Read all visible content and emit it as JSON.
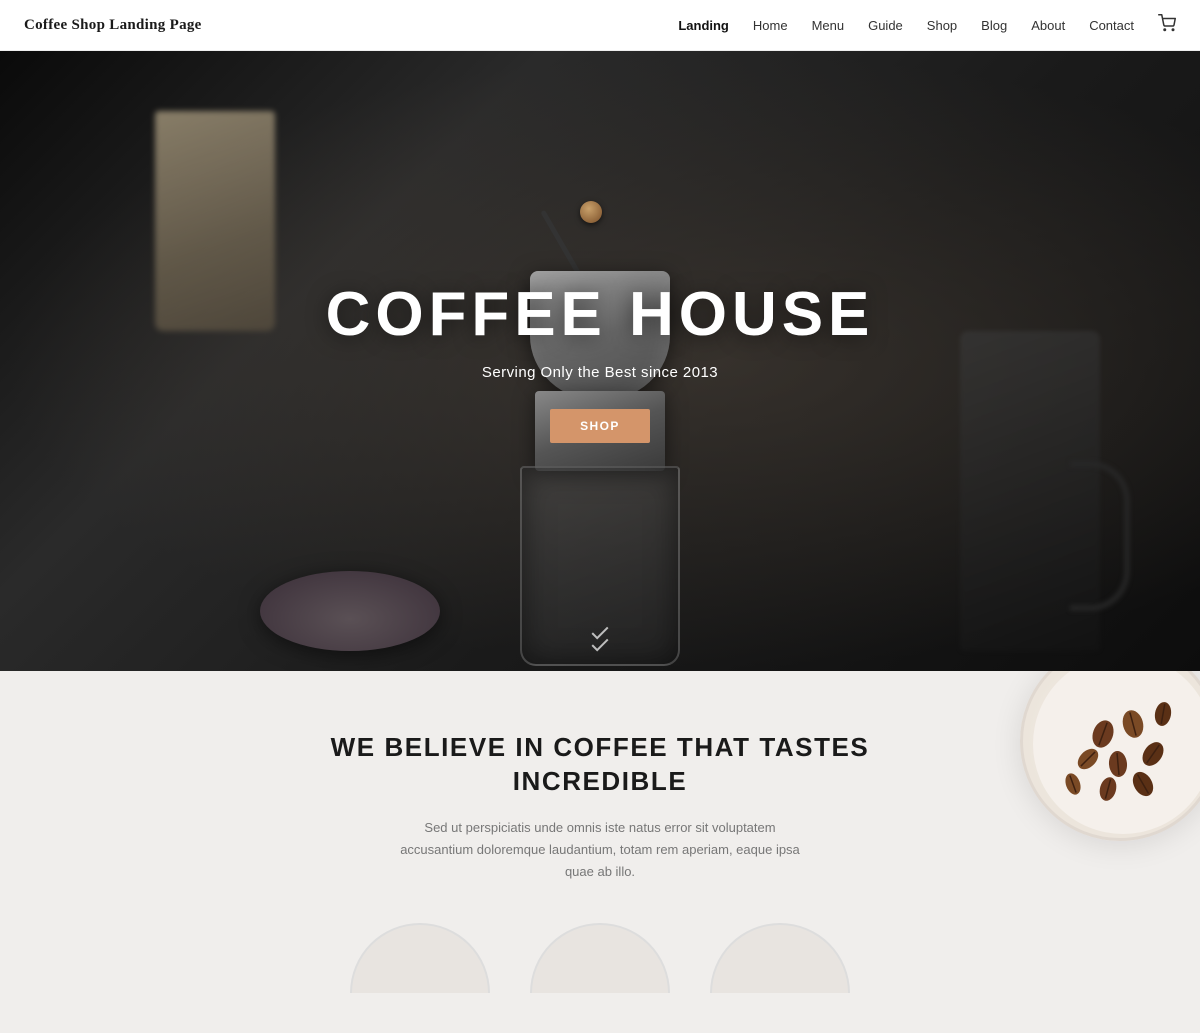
{
  "header": {
    "site_title": "Coffee Shop Landing Page",
    "nav_items": [
      {
        "label": "Landing",
        "active": true
      },
      {
        "label": "Home",
        "active": false
      },
      {
        "label": "Menu",
        "active": false
      },
      {
        "label": "Guide",
        "active": false
      },
      {
        "label": "Shop",
        "active": false
      },
      {
        "label": "Blog",
        "active": false
      },
      {
        "label": "About",
        "active": false
      },
      {
        "label": "Contact",
        "active": false
      }
    ],
    "cart_icon": "🛒"
  },
  "hero": {
    "title": "COFFEE HOUSE",
    "subtitle": "Serving Only the Best since 2013",
    "cta_label": "SHOP"
  },
  "about": {
    "heading_line1": "WE BELIEVE IN COFFEE THAT TASTES",
    "heading_line2": "INCREDIBLE",
    "body_text": "Sed ut perspiciatis unde omnis iste natus error sit voluptatem accusantium doloremque laudantium, totam rem aperiam, eaque ipsa quae ab illo."
  },
  "colors": {
    "accent": "#d4956a",
    "text_dark": "#1a1a1a",
    "text_muted": "#777777",
    "bg_light": "#f0eeec",
    "nav_active": "#111111"
  }
}
